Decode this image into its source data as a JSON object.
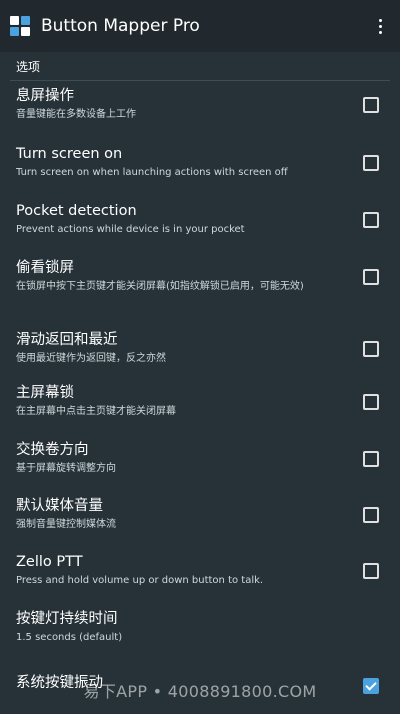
{
  "appbar": {
    "title": "Button Mapper Pro",
    "icon": "app-grid-icon",
    "menu_icon": "more-vert-icon"
  },
  "section": {
    "title": "选项"
  },
  "items": [
    {
      "title": "息屏操作",
      "subtitle": "音量键能在多数设备上工作",
      "checked": false
    },
    {
      "title": "Turn screen on",
      "subtitle": "Turn screen on when launching actions with screen off",
      "checked": false
    },
    {
      "title": "Pocket detection",
      "subtitle": "Prevent actions while device is in your pocket",
      "checked": false
    },
    {
      "title": "偷看锁屏",
      "subtitle": "在锁屏中按下主页键才能关闭屏幕(如指纹解锁已启用，可能无效)",
      "checked": false
    },
    {
      "title": "滑动返回和最近",
      "subtitle": "使用最近键作为返回键，反之亦然",
      "checked": false
    },
    {
      "title": "主屏幕锁",
      "subtitle": "在主屏幕中点击主页键才能关闭屏幕",
      "checked": false
    },
    {
      "title": "交换卷方向",
      "subtitle": "基于屏幕旋转调整方向",
      "checked": false
    },
    {
      "title": "默认媒体音量",
      "subtitle": "强制音量键控制媒体流",
      "checked": false
    },
    {
      "title": "Zello PTT",
      "subtitle": "Press and hold volume up or down button to talk.",
      "checked": false
    },
    {
      "title": "按键灯持续时间",
      "subtitle": "1.5 seconds (default)"
    },
    {
      "title": "系统按键振动",
      "checked": true
    }
  ],
  "watermark": {
    "text": "易下APP • 4008891800.COM"
  },
  "colors": {
    "background": "#263238",
    "appbar": "#21292e",
    "accent": "#4aa3df"
  }
}
